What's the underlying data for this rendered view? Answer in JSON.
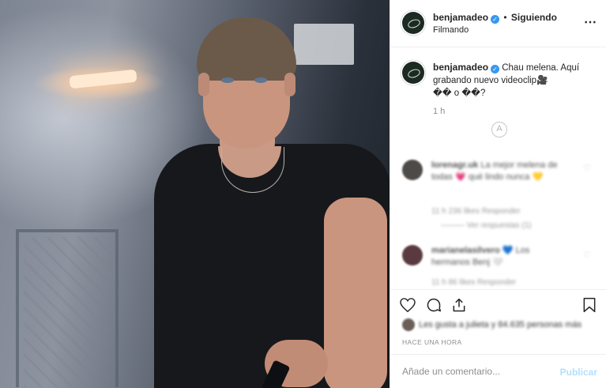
{
  "post": {
    "username": "benjamadeo",
    "follow_status": "Siguiendo",
    "separator": "•",
    "location": "Filmando",
    "more_icon": "⋯",
    "verified_icon": "✓",
    "caption_text": "Chau melena. Aquí grabando nuevo videoclip🎥",
    "caption_line2": "�� o ��?",
    "time_ago": "1 h",
    "translate_icon": "A"
  },
  "comments": [
    {
      "user": "lorenagr.uk",
      "text": "La mejor melena de todas 💗 qué lindo",
      "extra": "nunca 💛",
      "meta1": "11 h   236 likes   Responder",
      "meta2": "——— Ver respuestas (1)",
      "avatar_color": "#4e4a47"
    },
    {
      "user": "marianelasilvero",
      "text": "💙  Los hermanos Benj 🤍",
      "extra": "",
      "meta1": "11 h   86 likes   Responder",
      "meta2": "",
      "avatar_color": "#5a3a40"
    }
  ],
  "likes_text": "Les gusta a julieta y 84.635 personas más",
  "posted_label": "HACE UNA HORA",
  "composer": {
    "placeholder": "Añade un comentario...",
    "publish_label": "Publicar"
  },
  "colors": {
    "accent": "#3897f0",
    "publish_disabled": "#b2dffc",
    "muted": "#8e8e8e"
  }
}
